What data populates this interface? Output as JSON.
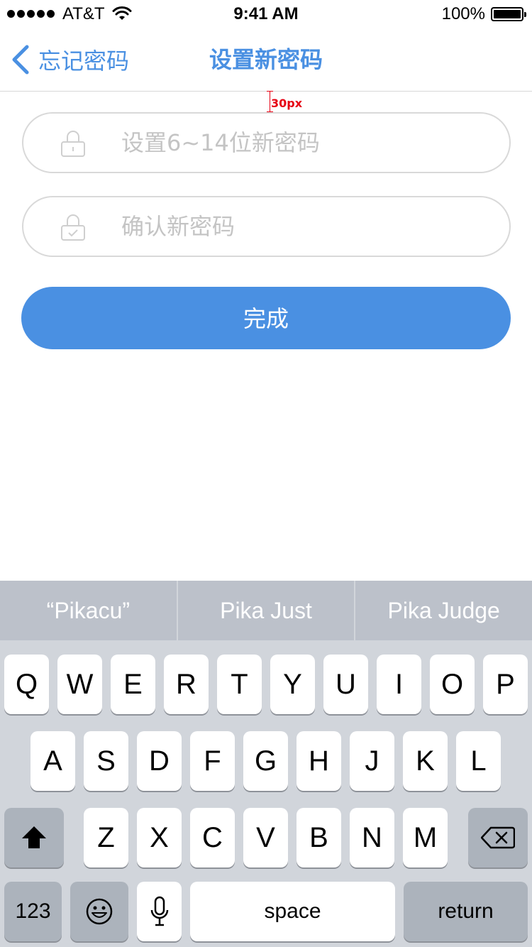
{
  "status_bar": {
    "carrier": "AT&T",
    "time": "9:41 AM",
    "battery_percent": "100%",
    "battery_level": 1.0,
    "signal_bars": 5,
    "wifi_icon": "wifi-icon",
    "battery_icon": "battery-icon"
  },
  "nav": {
    "back_label": "忘记密码",
    "back_icon": "chevron-left-icon",
    "title": "设置新密码"
  },
  "annotation": {
    "label": "30px",
    "color": "#e60012"
  },
  "form": {
    "new_password": {
      "placeholder": "设置6~14位新密码",
      "value": "",
      "icon": "lock-icon"
    },
    "confirm_password": {
      "placeholder": "确认新密码",
      "value": "",
      "icon": "lock-check-icon"
    },
    "submit_label": "完成"
  },
  "keyboard": {
    "suggestions": [
      "“Pikacu”",
      "Pika Just",
      "Pika Judge"
    ],
    "row1": [
      "Q",
      "W",
      "E",
      "R",
      "T",
      "Y",
      "U",
      "I",
      "O",
      "P"
    ],
    "row2": [
      "A",
      "S",
      "D",
      "F",
      "G",
      "H",
      "J",
      "K",
      "L"
    ],
    "row3": [
      "Z",
      "X",
      "C",
      "V",
      "B",
      "N",
      "M"
    ],
    "numbers_label": "123",
    "space_label": "space",
    "return_label": "return",
    "shift_icon": "shift-icon",
    "delete_icon": "delete-icon",
    "emoji_icon": "emoji-icon",
    "mic_icon": "microphone-icon"
  },
  "colors": {
    "accent": "#4a90e2",
    "border": "#d9d9d9",
    "placeholder": "#c4c4c4",
    "keyboard_bg": "#d1d5db",
    "suggestion_bar": "#bcc1ca",
    "function_key": "#acb3bc"
  }
}
